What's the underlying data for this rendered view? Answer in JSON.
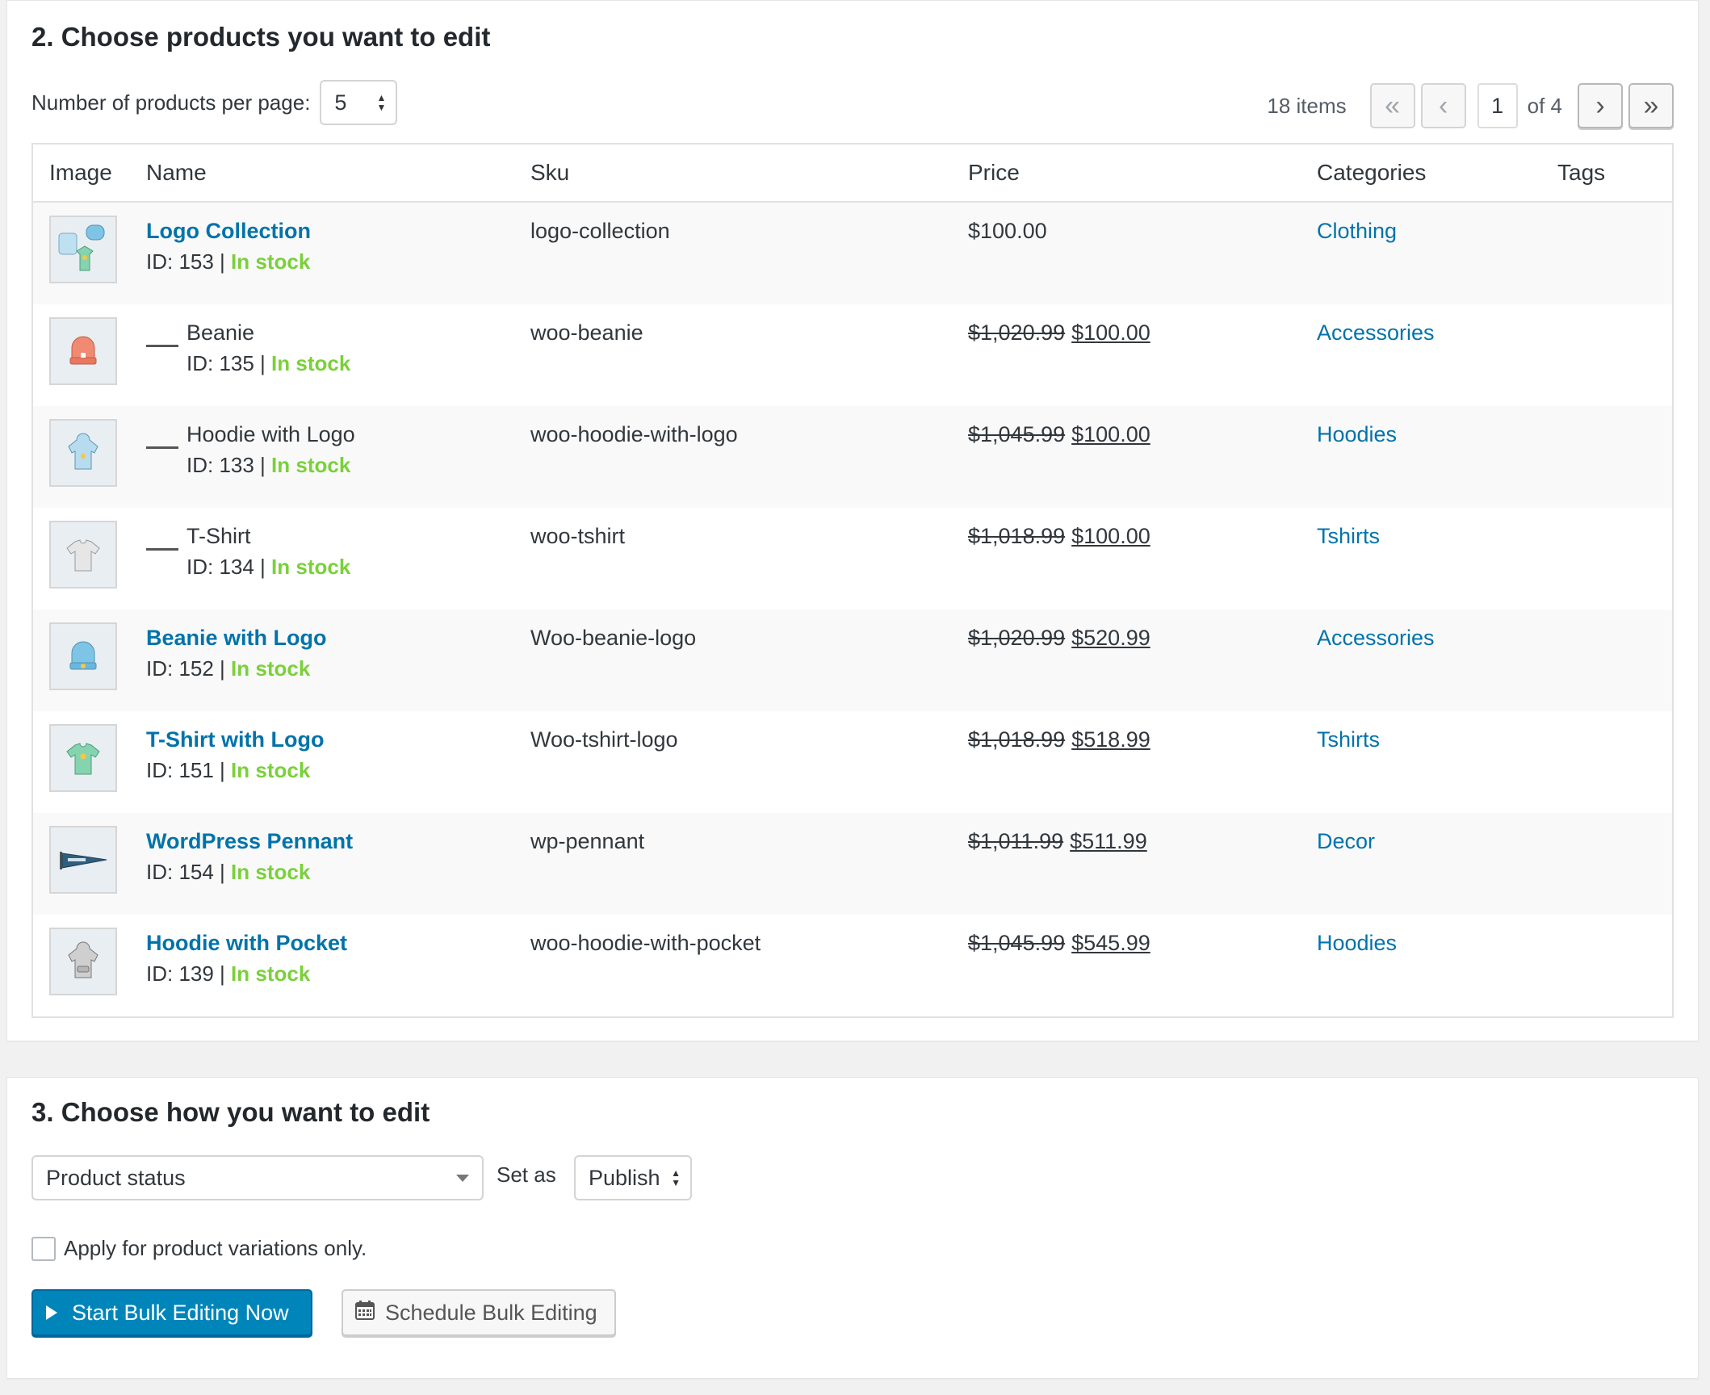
{
  "section2": {
    "title": "2. Choose products you want to edit",
    "per_page_label": "Number of products per page:",
    "per_page_value": "5",
    "pagination": {
      "items": "18 items",
      "first": "«",
      "prev": "‹",
      "current_page": "1",
      "of_total": "of 4",
      "next": "›",
      "last": "»"
    },
    "columns": [
      "Image",
      "Name",
      "Sku",
      "Price",
      "Categories",
      "Tags"
    ],
    "rows": [
      {
        "name": "Logo Collection",
        "id_text": "ID: 153 | ",
        "stock": "In stock",
        "sku": "logo-collection",
        "old_price": "",
        "price": "$100.00",
        "category": "Clothing",
        "child": false,
        "image_icon": "logo-collection-thumbnail"
      },
      {
        "name": "Beanie",
        "id_text": "ID: 135 | ",
        "stock": "In stock",
        "sku": "woo-beanie",
        "old_price": "$1,020.99",
        "price": "$100.00",
        "category": "Accessories",
        "child": true,
        "image_icon": "beanie-thumbnail"
      },
      {
        "name": "Hoodie with Logo",
        "id_text": "ID: 133 | ",
        "stock": "In stock",
        "sku": "woo-hoodie-with-logo",
        "old_price": "$1,045.99",
        "price": "$100.00",
        "category": "Hoodies",
        "child": true,
        "image_icon": "hoodie-logo-thumbnail"
      },
      {
        "name": "T-Shirt",
        "id_text": "ID: 134 | ",
        "stock": "In stock",
        "sku": "woo-tshirt",
        "old_price": "$1,018.99",
        "price": "$100.00",
        "category": "Tshirts",
        "child": true,
        "image_icon": "tshirt-thumbnail"
      },
      {
        "name": "Beanie with Logo",
        "id_text": "ID: 152 | ",
        "stock": "In stock",
        "sku": "Woo-beanie-logo",
        "old_price": "$1,020.99",
        "price": "$520.99",
        "category": "Accessories",
        "child": false,
        "image_icon": "beanie-logo-thumbnail"
      },
      {
        "name": "T-Shirt with Logo",
        "id_text": "ID: 151 | ",
        "stock": "In stock",
        "sku": "Woo-tshirt-logo",
        "old_price": "$1,018.99",
        "price": "$518.99",
        "category": "Tshirts",
        "child": false,
        "image_icon": "tshirt-logo-thumbnail"
      },
      {
        "name": "WordPress Pennant",
        "id_text": "ID: 154 | ",
        "stock": "In stock",
        "sku": "wp-pennant",
        "old_price": "$1,011.99",
        "price": "$511.99",
        "category": "Decor",
        "child": false,
        "image_icon": "pennant-thumbnail"
      },
      {
        "name": "Hoodie with Pocket",
        "id_text": "ID: 139 | ",
        "stock": "In stock",
        "sku": "woo-hoodie-with-pocket",
        "old_price": "$1,045.99",
        "price": "$545.99",
        "category": "Hoodies",
        "child": false,
        "image_icon": "hoodie-pocket-thumbnail"
      }
    ]
  },
  "section3": {
    "title": "3. Choose how you want to edit",
    "field_select": "Product status",
    "set_as_label": "Set as",
    "value_select": "Publish",
    "checkbox_label": "Apply for product variations only.",
    "start_button": "Start Bulk Editing Now",
    "schedule_button": "Schedule Bulk Editing"
  },
  "colors": {
    "link": "#0073aa",
    "in_stock": "#7ad03a",
    "primary_button": "#0085ba"
  }
}
